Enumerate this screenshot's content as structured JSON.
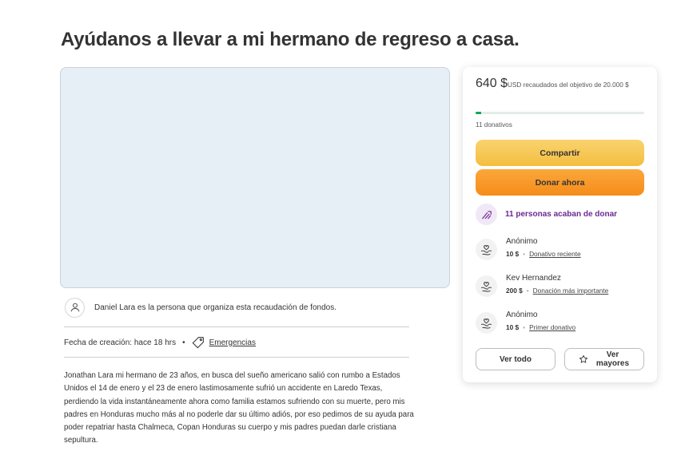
{
  "campaign": {
    "title": "Ayúdanos a llevar a mi hermano de regreso a casa.",
    "organizer_text": "Daniel Lara es la persona que organiza esta recaudación de fondos.",
    "created_text": "Fecha de creación: hace 18 hrs",
    "meta_separator": "•",
    "category_label": "Emergencias",
    "story": "Jonathan Lara mi hermano de 23 años, en busca del sueño americano salió con rumbo a Estados Unidos el 14 de enero y el 23 de enero lastimosamente sufrió un accidente en Laredo Texas, perdiendo la vida instantáneamente ahora como familia estamos sufriendo con su muerte, pero mis padres en Honduras mucho más al no poderle dar su último adiós, por eso pedimos de su ayuda para poder repatriar hasta Chalmeca, Copan Honduras su cuerpo y mis padres puedan darle cristiana sepultura."
  },
  "donation_card": {
    "amount_raised": "640 $",
    "raised_suffix": "USD recaudados del objetivo de 20.000 $",
    "progress_fraction": 0.032,
    "progress_color": "#02a95c",
    "donation_count": "11 donativos",
    "share_label": "Compartir",
    "donate_label": "Donar ahora",
    "recent_activity": "11 personas acaban de donar",
    "donors": [
      {
        "name": "Anónimo",
        "amount": "10 $",
        "separator": "•",
        "label": "Donativo reciente"
      },
      {
        "name": "Kev Hernandez",
        "amount": "200 $",
        "separator": "•",
        "label": "Donación más importante"
      },
      {
        "name": "Anónimo",
        "amount": "10 $",
        "separator": "•",
        "label": "Primer donativo"
      }
    ],
    "see_all_label": "Ver todo",
    "see_top_label": "Ver mayores",
    "icons": {
      "recent": "trending-up-icon",
      "donor": "heart-hand-icon",
      "top": "star-icon"
    },
    "accent_color": "#6a2a91"
  }
}
